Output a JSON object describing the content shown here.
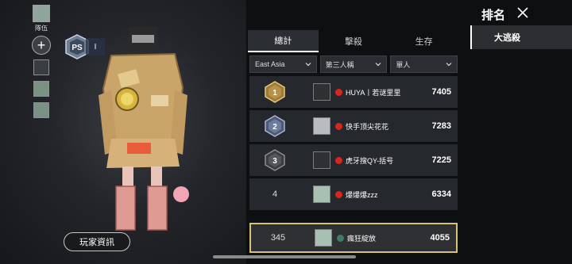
{
  "squad": {
    "label": "隊伍",
    "add_icon": "plus-icon"
  },
  "ps_badge": {
    "emblem": "PS",
    "level": "I"
  },
  "player_info_button": "玩家資訊",
  "tabs": [
    {
      "label": "總計",
      "active": true
    },
    {
      "label": "擊殺",
      "active": false
    },
    {
      "label": "生存",
      "active": false
    }
  ],
  "filters": [
    {
      "value": "East Asia"
    },
    {
      "value": "第三人稱"
    },
    {
      "value": "單人"
    }
  ],
  "leaderboard": [
    {
      "rank": "1",
      "rank_icon": "gold-rank-1-icon",
      "name": "HUYA丨若谜里里",
      "score": "7405"
    },
    {
      "rank": "2",
      "rank_icon": "silver-rank-2-icon",
      "name": "快手顶尖花花",
      "score": "7283"
    },
    {
      "rank": "3",
      "rank_icon": "bronze-rank-3-icon",
      "name": "虎牙搜QY-括号",
      "score": "7225"
    },
    {
      "rank": "4",
      "rank_icon": null,
      "name": "爆爆爆zzz",
      "score": "6334"
    }
  ],
  "self_entry": {
    "rank": "345",
    "name": "瘋狂綻放",
    "score": "4055"
  },
  "sidebar": {
    "title": "排名",
    "close_icon": "close-icon",
    "items": [
      {
        "label": "大逃殺",
        "active": true
      }
    ]
  },
  "colors": {
    "highlight_border": "#d8c27a",
    "flag_red": "#d9251d",
    "panel_row": "#25282c"
  }
}
